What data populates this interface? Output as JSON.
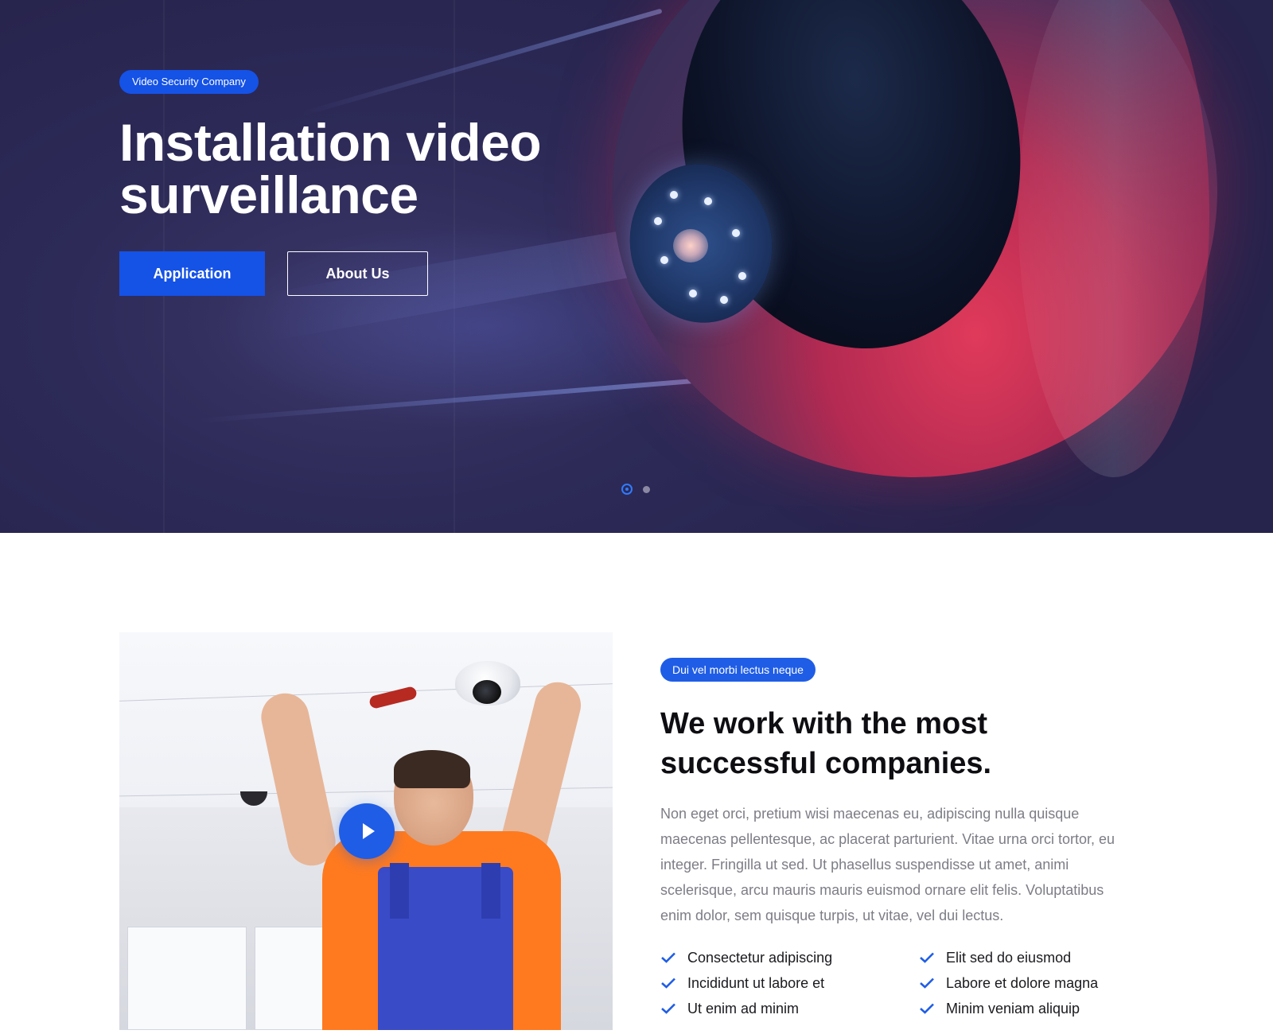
{
  "hero": {
    "badge": "Video Security Company",
    "title_line1": "Installation video",
    "title_line2": "surveillance",
    "primary_button": "Application",
    "secondary_button": "About Us",
    "slider": {
      "active_index": 0,
      "total": 2
    }
  },
  "about": {
    "badge": "Dui vel morbi lectus neque",
    "title_line1": "We work with the most",
    "title_line2": "successful companies.",
    "paragraph": "Non eget orci, pretium wisi maecenas eu, adipiscing nulla quisque maecenas pellentesque, ac placerat parturient. Vitae urna orci tortor, eu integer. Fringilla ut sed. Ut phasellus suspendisse ut amet, animi scelerisque, arcu mauris mauris euismod ornare elit felis. Voluptatibus enim dolor, sem quisque turpis, ut vitae, vel dui lectus.",
    "features_left": [
      "Consectetur adipiscing",
      "Incididunt ut labore et",
      "Ut enim ad minim"
    ],
    "features_right": [
      "Elit sed do eiusmod",
      "Labore et dolore magna",
      "Minim veniam aliquip"
    ],
    "play_icon": "play-icon",
    "check_icon": "check-icon"
  },
  "colors": {
    "accent": "#1552e6",
    "hero_bg": "#2d2a58",
    "text_muted": "#7d7d86",
    "check": "#1f5de6"
  }
}
